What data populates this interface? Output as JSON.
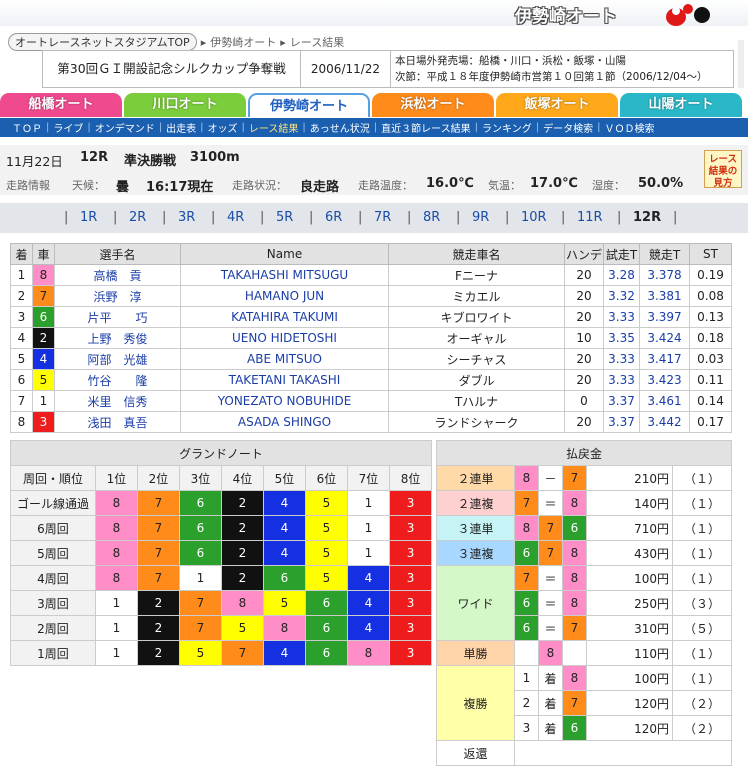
{
  "header": {
    "brand": "伊勢崎オート"
  },
  "breadcrumb": [
    "オートレースネットスタジアムTOP",
    "伊勢崎オート",
    "レース結果"
  ],
  "race_title": "第30回ＧＩ開設記念シルクカップ争奪戦",
  "race_date": "2006/11/22",
  "off_track_sales": "本日場外発売場：船橋・川口・浜松・飯塚・山陽",
  "next_meet": "次節：平成１８年度伊勢崎市営第１０回第１節（2006/12/04～）",
  "tracks": [
    {
      "label": "船橋オート",
      "color": "#f04a8e"
    },
    {
      "label": "川口オート",
      "color": "#7ccd3c"
    },
    {
      "label": "伊勢崎オート",
      "color": "#3a8ee0",
      "active": true
    },
    {
      "label": "浜松オート",
      "color": "#ff8c1a"
    },
    {
      "label": "飯塚オート",
      "color": "#ffa81a"
    },
    {
      "label": "山陽オート",
      "color": "#2ab8c8"
    }
  ],
  "subnav": [
    "ＴＯＰ",
    "ライブ",
    "オンデマンド",
    "出走表",
    "オッズ",
    "レース結果",
    "あっせん状況",
    "直近３節レース結果",
    "ランキング",
    "データ検索",
    "ＶＯＤ検索"
  ],
  "subnav_current": "レース結果",
  "race_info": {
    "date": "11月22日",
    "race_no": "12R",
    "race_kind": "準決勝戦",
    "distance": "3100m"
  },
  "track_info": {
    "label": "走路情報",
    "weather_label": "天候：",
    "weather": "曇",
    "time": "16:17現在",
    "surface_label": "走路状況：",
    "surface": "良走路",
    "track_temp_label": "走路温度：",
    "track_temp": "16.0℃",
    "air_temp_label": "気温：",
    "air_temp": "17.0℃",
    "humidity_label": "湿度：",
    "humidity": "50.0%"
  },
  "guide_button": "レース結果の見方",
  "race_links": [
    "1R",
    "2R",
    "3R",
    "4R",
    "5R",
    "6R",
    "7R",
    "8R",
    "9R",
    "10R",
    "11R",
    "12R"
  ],
  "race_current": "12R",
  "car_colors": {
    "1": {
      "bg": "#ffffff",
      "fg": "#222222"
    },
    "2": {
      "bg": "#111111",
      "fg": "#ffffff"
    },
    "3": {
      "bg": "#ee1c1c",
      "fg": "#ffffff"
    },
    "4": {
      "bg": "#1430e0",
      "fg": "#ffffff"
    },
    "5": {
      "bg": "#ffff00",
      "fg": "#222222"
    },
    "6": {
      "bg": "#2ca02c",
      "fg": "#ffffff"
    },
    "7": {
      "bg": "#ff8c1a",
      "fg": "#222222"
    },
    "8": {
      "bg": "#ff8ec8",
      "fg": "#222222"
    }
  },
  "entries": {
    "headers": [
      "着",
      "車",
      "選手名",
      "Name",
      "競走車名",
      "ハンデ",
      "試走T",
      "競走T",
      "ST"
    ],
    "rows": [
      {
        "pos": "1",
        "car": "8",
        "jp": "高橋　貢",
        "en": "TAKAHASHI MITSUGU",
        "machine": "Fニーナ",
        "handi": "20",
        "trial": "3.28",
        "race": "3.378",
        "st": "0.19"
      },
      {
        "pos": "2",
        "car": "7",
        "jp": "浜野　淳",
        "en": "HAMANO JUN",
        "machine": "ミカエル",
        "handi": "20",
        "trial": "3.32",
        "race": "3.381",
        "st": "0.08"
      },
      {
        "pos": "3",
        "car": "6",
        "jp": "片平　　巧",
        "en": "KATAHIRA TAKUMI",
        "machine": "キブロワイト",
        "handi": "20",
        "trial": "3.33",
        "race": "3.397",
        "st": "0.13"
      },
      {
        "pos": "4",
        "car": "2",
        "jp": "上野　秀俊",
        "en": "UENO HIDETOSHI",
        "machine": "オーギャル",
        "handi": "10",
        "trial": "3.35",
        "race": "3.424",
        "st": "0.18"
      },
      {
        "pos": "5",
        "car": "4",
        "jp": "阿部　光雄",
        "en": "ABE MITSUO",
        "machine": "シーチャス",
        "handi": "20",
        "trial": "3.33",
        "race": "3.417",
        "st": "0.03"
      },
      {
        "pos": "6",
        "car": "5",
        "jp": "竹谷　　隆",
        "en": "TAKETANI TAKASHI",
        "machine": "ダブル",
        "handi": "20",
        "trial": "3.33",
        "race": "3.423",
        "st": "0.11"
      },
      {
        "pos": "7",
        "car": "1",
        "jp": "米里　信秀",
        "en": "YONEZATO NOBUHIDE",
        "machine": "Tハルナ",
        "handi": "0",
        "trial": "3.37",
        "race": "3.461",
        "st": "0.14"
      },
      {
        "pos": "8",
        "car": "3",
        "jp": "浅田　真吾",
        "en": "ASADA SHINGO",
        "machine": "ランドシャーク",
        "handi": "20",
        "trial": "3.37",
        "race": "3.442",
        "st": "0.17"
      }
    ]
  },
  "grand_note": {
    "title": "グランドノート",
    "header_label": "周回・順位",
    "positions": [
      "1位",
      "2位",
      "3位",
      "4位",
      "5位",
      "6位",
      "7位",
      "8位"
    ],
    "rows": [
      {
        "label": "ゴール線通過",
        "cars": [
          "8",
          "7",
          "6",
          "2",
          "4",
          "5",
          "1",
          "3"
        ]
      },
      {
        "label": "6周回",
        "cars": [
          "8",
          "7",
          "6",
          "2",
          "4",
          "5",
          "1",
          "3"
        ]
      },
      {
        "label": "5周回",
        "cars": [
          "8",
          "7",
          "6",
          "2",
          "4",
          "5",
          "1",
          "3"
        ]
      },
      {
        "label": "4周回",
        "cars": [
          "8",
          "7",
          "1",
          "2",
          "6",
          "5",
          "4",
          "3"
        ]
      },
      {
        "label": "3周回",
        "cars": [
          "1",
          "2",
          "7",
          "8",
          "5",
          "6",
          "4",
          "3"
        ]
      },
      {
        "label": "2周回",
        "cars": [
          "1",
          "2",
          "7",
          "5",
          "8",
          "6",
          "4",
          "3"
        ]
      },
      {
        "label": "1周回",
        "cars": [
          "1",
          "2",
          "5",
          "7",
          "4",
          "6",
          "8",
          "3"
        ]
      }
    ]
  },
  "payout": {
    "title": "払戻金",
    "exacta": {
      "label": "２連単",
      "a": "8",
      "sep": "－",
      "b": "7",
      "yen": "210円",
      "pop": "（１）",
      "color": "#ffd9a8"
    },
    "quinella": {
      "label": "２連複",
      "a": "7",
      "sep": "＝",
      "b": "8",
      "yen": "140円",
      "pop": "（１）",
      "color": "#ffd0d0"
    },
    "trifecta": {
      "label": "３連単",
      "cars": [
        "8",
        "7",
        "6"
      ],
      "yen": "710円",
      "pop": "（１）",
      "color": "#c6f4f6"
    },
    "trio": {
      "label": "３連複",
      "cars": [
        "6",
        "7",
        "8"
      ],
      "yen": "430円",
      "pop": "（１）",
      "color": "#a8d8ff"
    },
    "wide": {
      "label": "ワイド",
      "color": "#d4f8c8",
      "rows": [
        {
          "a": "7",
          "sep": "＝",
          "b": "8",
          "yen": "100円",
          "pop": "（１）"
        },
        {
          "a": "6",
          "sep": "＝",
          "b": "8",
          "yen": "250円",
          "pop": "（３）"
        },
        {
          "a": "6",
          "sep": "＝",
          "b": "7",
          "yen": "310円",
          "pop": "（５）"
        }
      ]
    },
    "win": {
      "label": "単勝",
      "car": "8",
      "yen": "110円",
      "pop": "（１）",
      "color": "#ffd4a8"
    },
    "place": {
      "label": "複勝",
      "color": "#ffffa8",
      "rows": [
        {
          "rank": "1",
          "unit": "着",
          "car": "8",
          "yen": "100円",
          "pop": "（１）"
        },
        {
          "rank": "2",
          "unit": "着",
          "car": "7",
          "yen": "120円",
          "pop": "（２）"
        },
        {
          "rank": "3",
          "unit": "着",
          "car": "6",
          "yen": "120円",
          "pop": "（２）"
        }
      ]
    },
    "refund": {
      "label": "返還"
    }
  }
}
